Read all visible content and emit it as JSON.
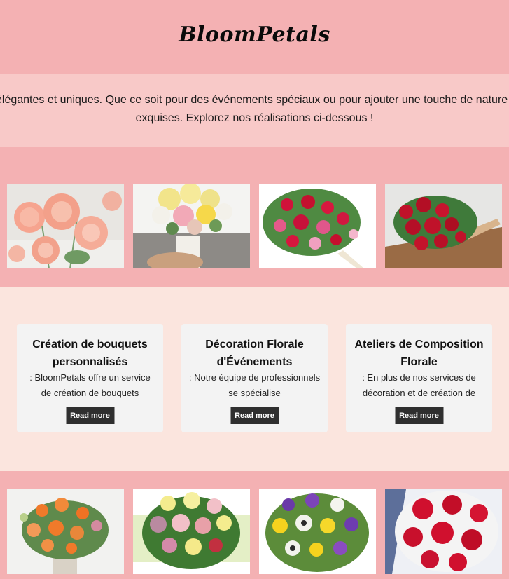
{
  "header": {
    "brand": "BloomPetals"
  },
  "intro": {
    "line1": "élégantes et uniques. Que ce soit pour des événements spéciaux ou pour ajouter une touche de nature",
    "line2": "exquises. Explorez nos réalisations ci-dessous !"
  },
  "gallery_top": [
    {
      "icon": "peach-dahlia-bouquet-photo",
      "accent": "#f6a48f"
    },
    {
      "icon": "pastel-rose-bouquet-in-hand-photo",
      "accent": "#f4e27c"
    },
    {
      "icon": "red-pink-lily-bouquet-photo",
      "accent": "#c8123a"
    },
    {
      "icon": "red-rose-bouquet-photo",
      "accent": "#c0122a"
    }
  ],
  "services": [
    {
      "title": "Création de bouquets personnalisés",
      "text": ": BloomPetals offre un service de création de bouquets",
      "button": "Read more"
    },
    {
      "title": "Décoration Florale d'Événements",
      "text": ": Notre équipe de professionnels se spécialise",
      "button": "Read more"
    },
    {
      "title": "Ateliers de Composition Florale",
      "text": ": En plus de nos services de décoration et de création de",
      "button": "Read more"
    }
  ],
  "gallery_bottom": [
    {
      "icon": "orange-flower-vase-photo",
      "accent": "#f07a2a"
    },
    {
      "icon": "mixed-rose-bouquet-photo",
      "accent": "#f2c0c8"
    },
    {
      "icon": "purple-yellow-white-bouquet-photo",
      "accent": "#6a3aa8"
    },
    {
      "icon": "red-rose-babys-breath-photo",
      "accent": "#d0102e"
    }
  ],
  "colors": {
    "header_bg": "#f4b1b3",
    "intro_bg": "#f8c9c8",
    "services_bg": "#fbe5de",
    "card_bg": "#f3f3f3",
    "button_bg": "#2f2f2f"
  }
}
